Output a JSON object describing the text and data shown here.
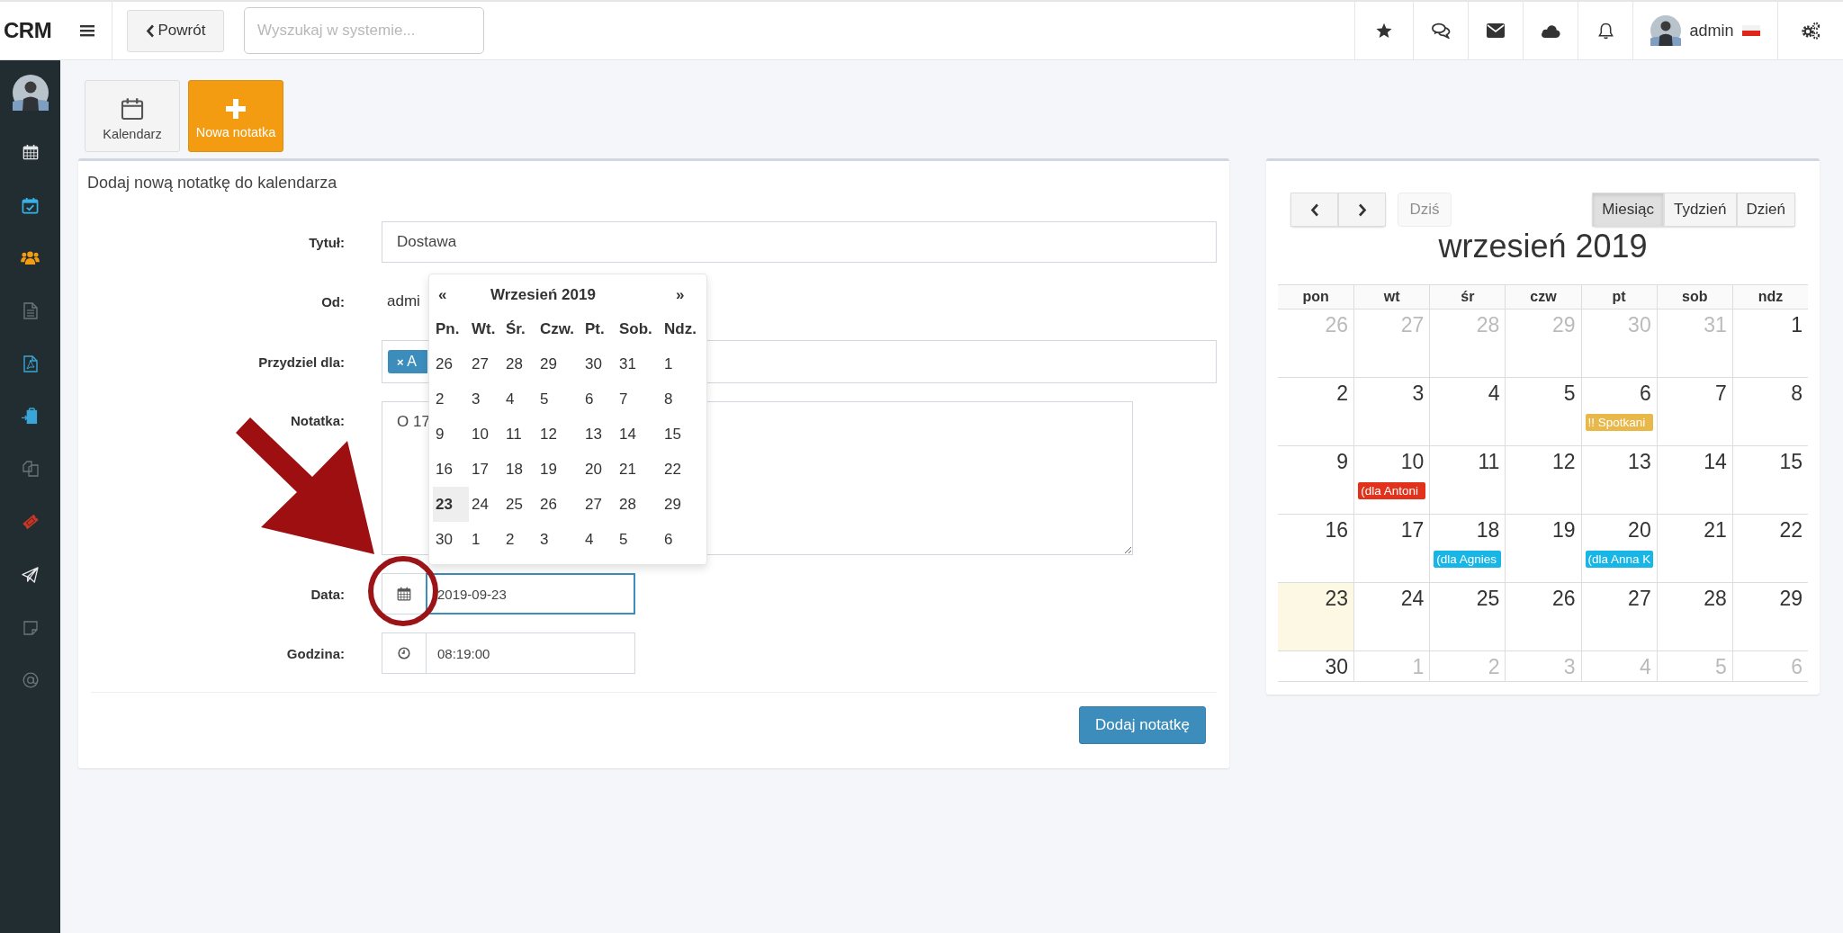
{
  "topbar": {
    "logo": "CRM",
    "back_button": "Powrót",
    "search": {
      "placeholder": "Wyszukaj w systemie..."
    },
    "user": {
      "name": "admin"
    }
  },
  "toolbar": [
    {
      "kind": "calendar",
      "label": "Kalendarz"
    },
    {
      "kind": "add",
      "label": "Nowa notatka"
    }
  ],
  "form": {
    "title": "Dodaj nową notatkę do kalendarza",
    "fields": [
      {
        "kind": "text",
        "label": "Tytuł:",
        "value": "Dostawa",
        "focused": false
      },
      {
        "kind": "static",
        "label": "Od:",
        "value": "admi"
      },
      {
        "kind": "tags",
        "label": "Przydziel dla:",
        "tags": [
          {
            "remove": "×",
            "text": "A"
          }
        ],
        "focused": false
      },
      {
        "kind": "textarea",
        "label": "Notatka:",
        "value": "O 17",
        "focused": false
      },
      {
        "kind": "date",
        "label": "Data:",
        "value": "2019-09-23",
        "focused": true
      },
      {
        "kind": "time",
        "label": "Godzina:",
        "value": "08:19:00",
        "focused": false
      }
    ],
    "submit": "Dodaj notatkę"
  },
  "datepicker": {
    "prev": "«",
    "title": "Wrzesień 2019",
    "next": "»",
    "weekdays": [
      "Pn.",
      "Wt.",
      "Śr.",
      "Czw.",
      "Pt.",
      "Sob.",
      "Ndz."
    ],
    "weeks": [
      [
        {
          "day": "26",
          "selected": false
        },
        {
          "day": "27",
          "selected": false
        },
        {
          "day": "28",
          "selected": false
        },
        {
          "day": "29",
          "selected": false
        },
        {
          "day": "30",
          "selected": false
        },
        {
          "day": "31",
          "selected": false
        },
        {
          "day": "1",
          "selected": false
        }
      ],
      [
        {
          "day": "2",
          "selected": false
        },
        {
          "day": "3",
          "selected": false
        },
        {
          "day": "4",
          "selected": false
        },
        {
          "day": "5",
          "selected": false
        },
        {
          "day": "6",
          "selected": false
        },
        {
          "day": "7",
          "selected": false
        },
        {
          "day": "8",
          "selected": false
        }
      ],
      [
        {
          "day": "9",
          "selected": false
        },
        {
          "day": "10",
          "selected": false
        },
        {
          "day": "11",
          "selected": false
        },
        {
          "day": "12",
          "selected": false
        },
        {
          "day": "13",
          "selected": false
        },
        {
          "day": "14",
          "selected": false
        },
        {
          "day": "15",
          "selected": false
        }
      ],
      [
        {
          "day": "16",
          "selected": false
        },
        {
          "day": "17",
          "selected": false
        },
        {
          "day": "18",
          "selected": false
        },
        {
          "day": "19",
          "selected": false
        },
        {
          "day": "20",
          "selected": false
        },
        {
          "day": "21",
          "selected": false
        },
        {
          "day": "22",
          "selected": false
        }
      ],
      [
        {
          "day": "23",
          "selected": true
        },
        {
          "day": "24",
          "selected": false
        },
        {
          "day": "25",
          "selected": false
        },
        {
          "day": "26",
          "selected": false
        },
        {
          "day": "27",
          "selected": false
        },
        {
          "day": "28",
          "selected": false
        },
        {
          "day": "29",
          "selected": false
        }
      ],
      [
        {
          "day": "30",
          "selected": false
        },
        {
          "day": "1",
          "selected": false
        },
        {
          "day": "2",
          "selected": false
        },
        {
          "day": "3",
          "selected": false
        },
        {
          "day": "4",
          "selected": false
        },
        {
          "day": "5",
          "selected": false
        },
        {
          "day": "6",
          "selected": false
        }
      ]
    ]
  },
  "calendar": {
    "today_button": {
      "label": "Dziś",
      "disabled": true
    },
    "views": [
      {
        "label": "Miesiąc",
        "selected": true
      },
      {
        "label": "Tydzień",
        "selected": false
      },
      {
        "label": "Dzień",
        "selected": false
      }
    ],
    "title": "wrzesień 2019",
    "weekdays": [
      "pon",
      "wt",
      "śr",
      "czw",
      "pt",
      "sob",
      "ndz"
    ],
    "weeks": [
      [
        {
          "day": "26",
          "other_month": true,
          "today": false
        },
        {
          "day": "27",
          "other_month": true,
          "today": false
        },
        {
          "day": "28",
          "other_month": true,
          "today": false
        },
        {
          "day": "29",
          "other_month": true,
          "today": false
        },
        {
          "day": "30",
          "other_month": true,
          "today": false
        },
        {
          "day": "31",
          "other_month": true,
          "today": false
        },
        {
          "day": "1",
          "other_month": false,
          "today": false
        }
      ],
      [
        {
          "day": "2",
          "other_month": false,
          "today": false
        },
        {
          "day": "3",
          "other_month": false,
          "today": false
        },
        {
          "day": "4",
          "other_month": false,
          "today": false
        },
        {
          "day": "5",
          "other_month": false,
          "today": false
        },
        {
          "day": "6",
          "other_month": false,
          "today": false,
          "events": [
            {
              "title": "!! Spotkani",
              "color": "#e8b84a"
            }
          ]
        },
        {
          "day": "7",
          "other_month": false,
          "today": false
        },
        {
          "day": "8",
          "other_month": false,
          "today": false
        }
      ],
      [
        {
          "day": "9",
          "other_month": false,
          "today": false
        },
        {
          "day": "10",
          "other_month": false,
          "today": false,
          "events": [
            {
              "title": "(dla Antoni",
              "color": "#e3321c"
            }
          ]
        },
        {
          "day": "11",
          "other_month": false,
          "today": false
        },
        {
          "day": "12",
          "other_month": false,
          "today": false
        },
        {
          "day": "13",
          "other_month": false,
          "today": false
        },
        {
          "day": "14",
          "other_month": false,
          "today": false
        },
        {
          "day": "15",
          "other_month": false,
          "today": false
        }
      ],
      [
        {
          "day": "16",
          "other_month": false,
          "today": false
        },
        {
          "day": "17",
          "other_month": false,
          "today": false
        },
        {
          "day": "18",
          "other_month": false,
          "today": false,
          "events": [
            {
              "title": "(dla Agnies",
              "color": "#17b6e6"
            }
          ]
        },
        {
          "day": "19",
          "other_month": false,
          "today": false
        },
        {
          "day": "20",
          "other_month": false,
          "today": false,
          "events": [
            {
              "title": "(dla Anna K",
              "color": "#17b6e6"
            }
          ]
        },
        {
          "day": "21",
          "other_month": false,
          "today": false
        },
        {
          "day": "22",
          "other_month": false,
          "today": false
        }
      ],
      [
        {
          "day": "23",
          "other_month": false,
          "today": true
        },
        {
          "day": "24",
          "other_month": false,
          "today": false
        },
        {
          "day": "25",
          "other_month": false,
          "today": false
        },
        {
          "day": "26",
          "other_month": false,
          "today": false
        },
        {
          "day": "27",
          "other_month": false,
          "today": false
        },
        {
          "day": "28",
          "other_month": false,
          "today": false
        },
        {
          "day": "29",
          "other_month": false,
          "today": false
        }
      ],
      [
        {
          "day": "30",
          "other_month": false,
          "today": false
        },
        {
          "day": "1",
          "other_month": true,
          "today": false
        },
        {
          "day": "2",
          "other_month": true,
          "today": false
        },
        {
          "day": "3",
          "other_month": true,
          "today": false
        },
        {
          "day": "4",
          "other_month": true,
          "today": false
        },
        {
          "day": "5",
          "other_month": true,
          "today": false
        },
        {
          "day": "6",
          "other_month": true,
          "today": false
        }
      ]
    ]
  }
}
